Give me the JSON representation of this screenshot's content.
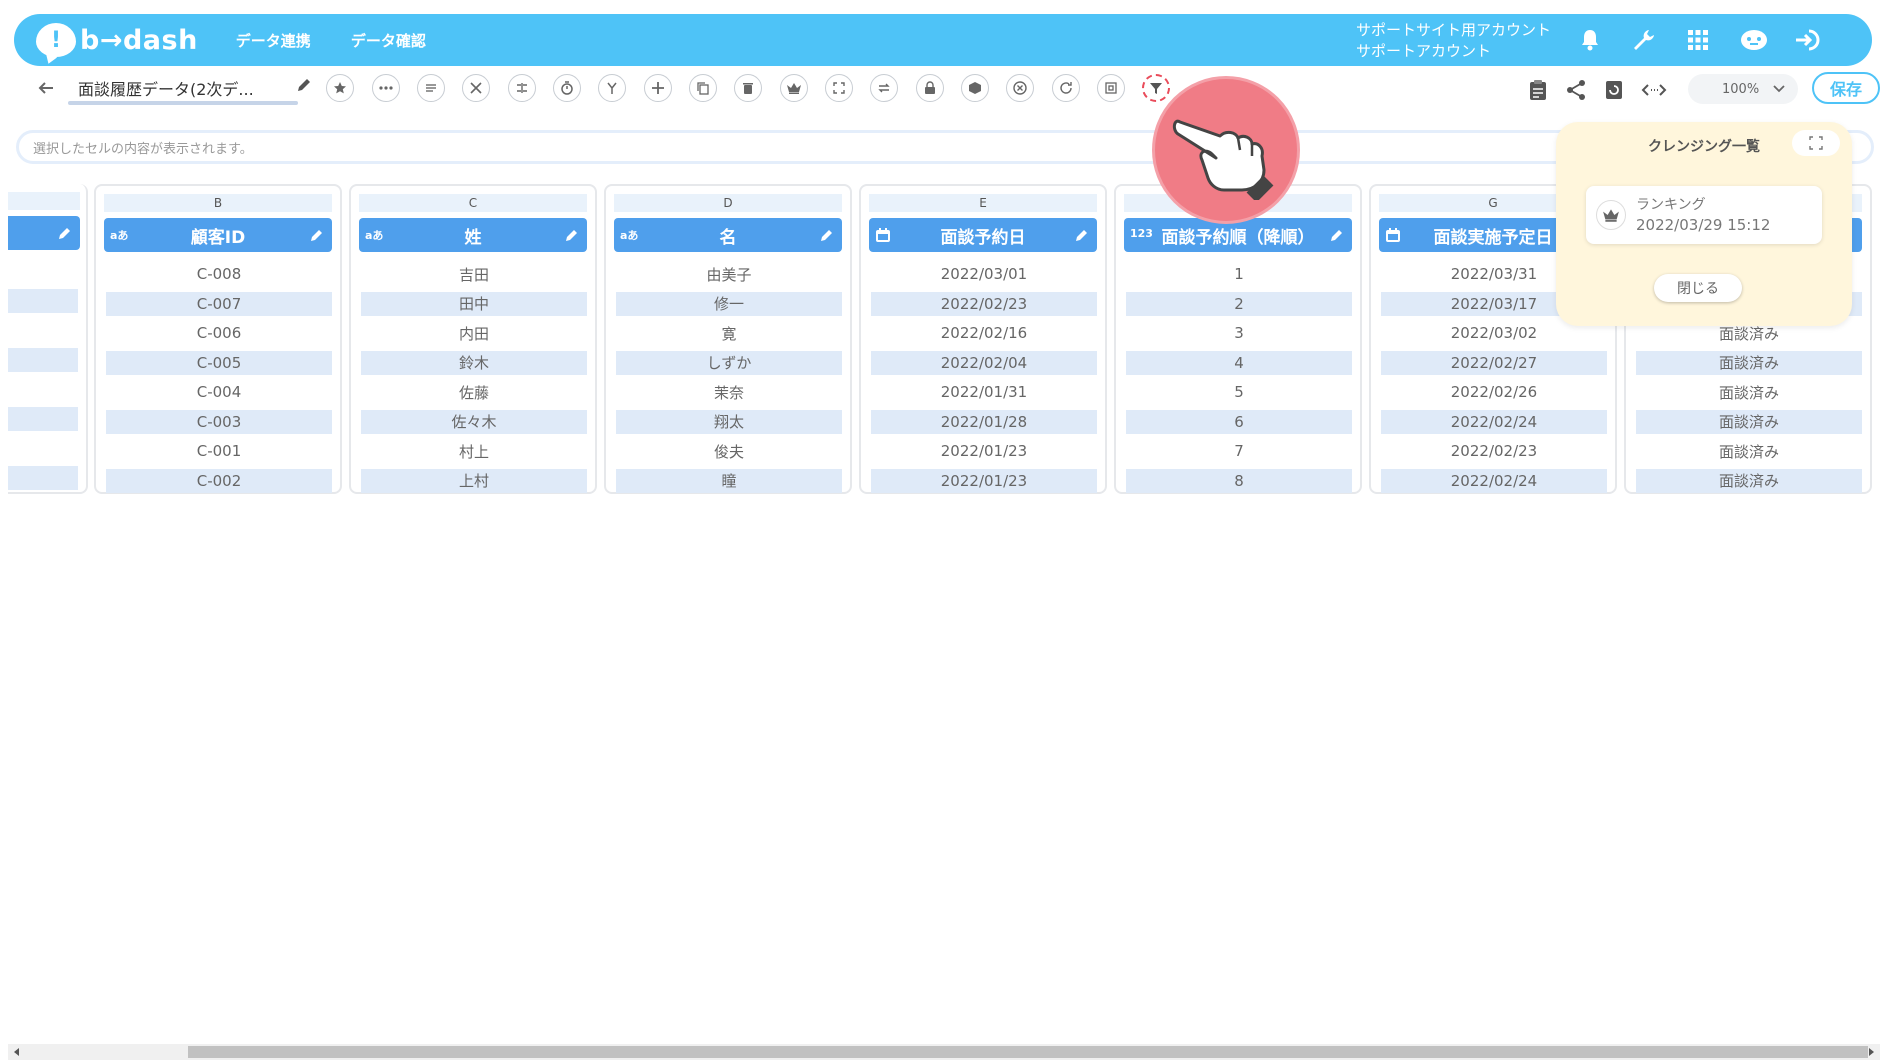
{
  "header": {
    "logo_text": "b→dash",
    "nav": [
      "データ連携",
      "データ確認"
    ],
    "account_line1": "サポートサイト用アカウント",
    "account_line2": "サポートアカウント",
    "icons": [
      "bell-icon",
      "wrench-icon",
      "grid-icon",
      "robot-icon",
      "logout-icon"
    ]
  },
  "toolbar": {
    "title": "面談履歴データ(2次デ...",
    "zoom": "100%",
    "save_label": "保存",
    "tools": [
      "star-icon",
      "ellipsis-icon",
      "list-icon",
      "tools-icon",
      "merge-icon",
      "timer-icon",
      "branch-icon",
      "plus-icon",
      "copy-icon",
      "trash-icon",
      "crown-icon",
      "expand-icon",
      "loop-icon",
      "lock-icon",
      "box-icon",
      "close-circle-icon",
      "refresh-icon",
      "frame-icon",
      "filter-icon"
    ],
    "right_icons": [
      "clipboard-icon",
      "share-icon",
      "history-icon",
      "code-icon"
    ]
  },
  "cellbar": {
    "placeholder": "選択したセルの内容が表示されます。"
  },
  "columns": [
    {
      "letter": "B",
      "header": "顧客ID",
      "type": "aあ",
      "cells": [
        "C-008",
        "C-007",
        "C-006",
        "C-005",
        "C-004",
        "C-003",
        "C-001",
        "C-002"
      ]
    },
    {
      "letter": "C",
      "header": "姓",
      "type": "aあ",
      "cells": [
        "吉田",
        "田中",
        "内田",
        "鈴木",
        "佐藤",
        "佐々木",
        "村上",
        "上村"
      ]
    },
    {
      "letter": "D",
      "header": "名",
      "type": "aあ",
      "cells": [
        "由美子",
        "修一",
        "寛",
        "しずか",
        "茉奈",
        "翔太",
        "俊夫",
        "瞳"
      ]
    },
    {
      "letter": "E",
      "header": "面談予約日",
      "type": "date",
      "cells": [
        "2022/03/01",
        "2022/02/23",
        "2022/02/16",
        "2022/02/04",
        "2022/01/31",
        "2022/01/28",
        "2022/01/23",
        "2022/01/23"
      ]
    },
    {
      "letter": "",
      "header": "面談予約順（降順）",
      "type": "123",
      "cells": [
        "1",
        "2",
        "3",
        "4",
        "5",
        "6",
        "7",
        "8"
      ]
    },
    {
      "letter": "G",
      "header": "面談実施予定日",
      "type": "date",
      "cells": [
        "2022/03/31",
        "2022/03/17",
        "2022/03/02",
        "2022/02/27",
        "2022/02/26",
        "2022/02/24",
        "2022/02/23",
        "2022/02/24"
      ]
    },
    {
      "letter": "",
      "header": "",
      "type": "",
      "cells": [
        "",
        "",
        "面談済み",
        "面談済み",
        "面談済み",
        "面談済み",
        "面談済み",
        "面談済み"
      ]
    }
  ],
  "popup": {
    "title": "クレンジング一覧",
    "item_name": "ランキング",
    "item_date": "2022/03/29 15:12",
    "close_label": "閉じる"
  }
}
